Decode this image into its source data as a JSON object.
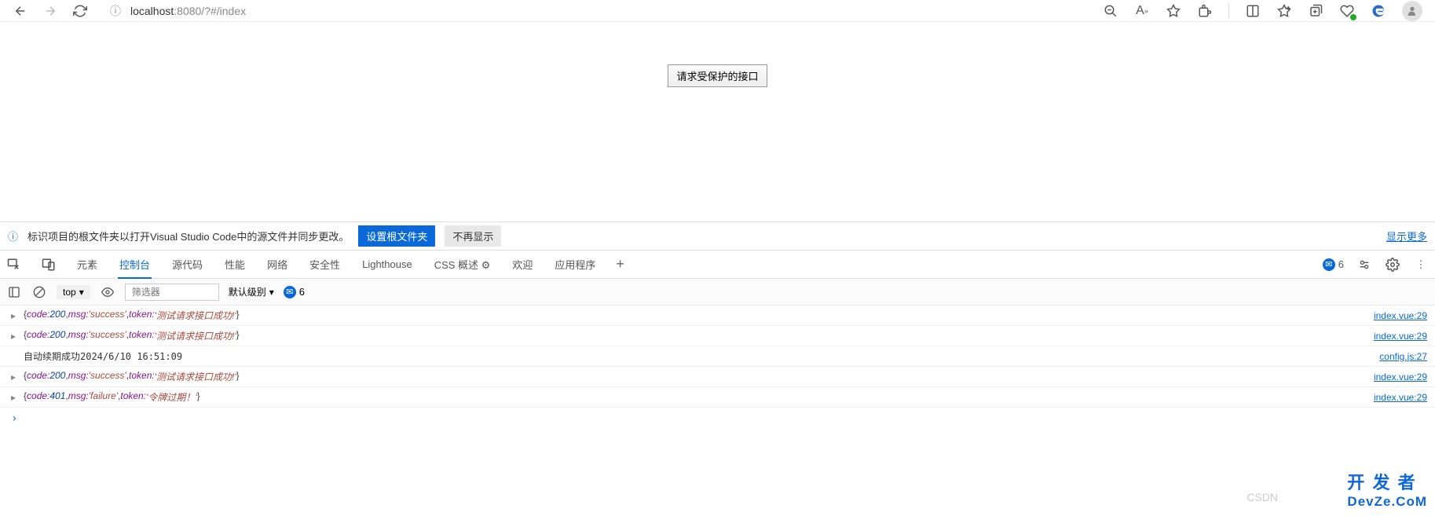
{
  "browser": {
    "url_host": "localhost",
    "url_port_path": ":8080/?#/index"
  },
  "page": {
    "button_label": "请求受保护的接口"
  },
  "infobar": {
    "text": "标识项目的根文件夹以打开Visual Studio Code中的源文件并同步更改。",
    "btn_primary": "设置根文件夹",
    "btn_secondary": "不再显示",
    "more_link": "显示更多"
  },
  "devtools": {
    "tabs": [
      "元素",
      "控制台",
      "源代码",
      "性能",
      "网络",
      "安全性",
      "Lighthouse",
      "CSS 概述 ⚙",
      "欢迎",
      "应用程序"
    ],
    "active_index": 1,
    "issues_count": "6"
  },
  "console_toolbar": {
    "context": "top",
    "filter_placeholder": "筛选器",
    "level_label": "默认级别",
    "msg_count": "6"
  },
  "console": {
    "rows": [
      {
        "type": "obj",
        "code": "200",
        "msg": "'success'",
        "token": "'测试请求接口成功!'",
        "src": "index.vue:29"
      },
      {
        "type": "obj",
        "code": "200",
        "msg": "'success'",
        "token": "'测试请求接口成功!'",
        "src": "index.vue:29"
      },
      {
        "type": "plain",
        "text": "自动续期成功2024/6/10 16:51:09",
        "src": "config.js:27"
      },
      {
        "type": "obj",
        "code": "200",
        "msg": "'success'",
        "token": "'测试请求接口成功!'",
        "src": "index.vue:29"
      },
      {
        "type": "obj",
        "code": "401",
        "msg": "'failure'",
        "token": "'令牌过期！'",
        "src": "index.vue:29"
      }
    ]
  },
  "watermark": {
    "line1": "开 发 者",
    "line2": "DevZe.CoM",
    "csdn": "CSDN"
  }
}
